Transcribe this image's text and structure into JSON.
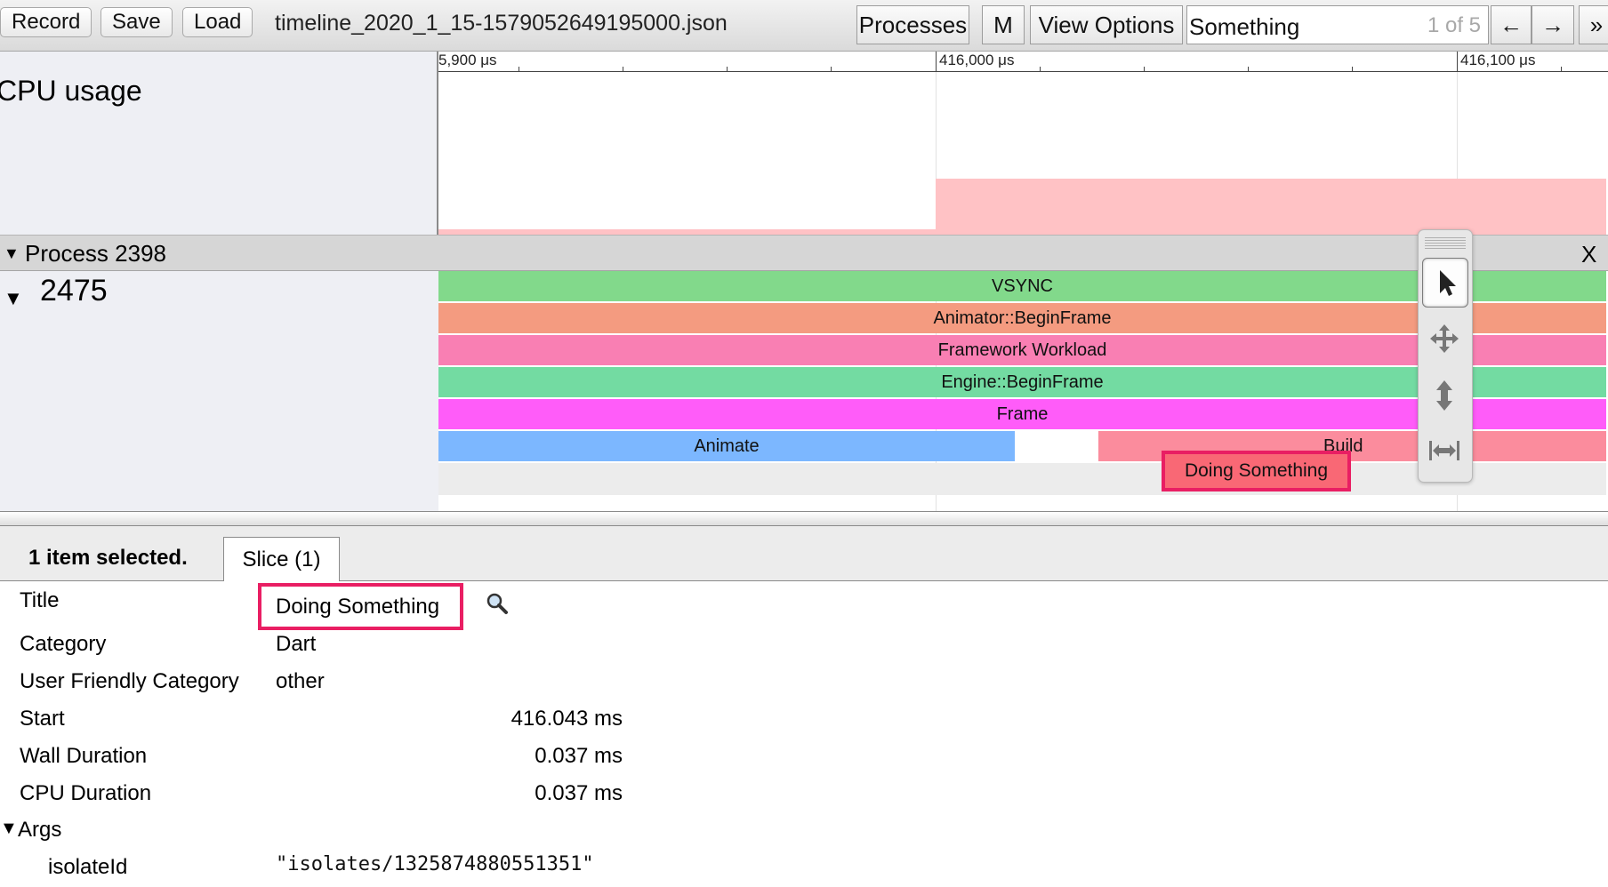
{
  "toolbar": {
    "record_label": "Record",
    "save_label": "Save",
    "load_label": "Load",
    "filename": "timeline_2020_1_15-1579052649195000.json",
    "processes_label": "Processes",
    "m_label": "M",
    "view_options_label": "View Options",
    "search_value": "Something",
    "search_count": "1 of 5",
    "prev_label": "←",
    "next_label": "→",
    "more_label": "»"
  },
  "ruler": {
    "labels": [
      "5,900 μs",
      "416,000 μs",
      "416,100 μs"
    ]
  },
  "tracks": {
    "cpu_label": "CPU usage",
    "process_title": "Process 2398",
    "process_close": "X",
    "thread_id": "2475"
  },
  "slices": {
    "vsync": "VSYNC",
    "animator_begin": "Animator::BeginFrame",
    "framework": "Framework Workload",
    "engine_begin": "Engine::BeginFrame",
    "frame": "Frame",
    "animate": "Animate",
    "build": "Build",
    "doing_something": "Doing Something"
  },
  "colors": {
    "vsync": "#82d98b",
    "animator_begin": "#f49b80",
    "framework": "#f97fb3",
    "engine_begin": "#73dba2",
    "frame": "#ff5cf9",
    "animate": "#7cb7ff",
    "build": "#fb8c9d",
    "doing_something": "#f96875",
    "selection": "#e91e63"
  },
  "panel": {
    "selected_text": "1 item selected.",
    "tab_label": "Slice (1)",
    "rows": {
      "title_label": "Title",
      "title_value": "Doing Something",
      "category_label": "Category",
      "category_value": "Dart",
      "ufc_label": "User Friendly Category",
      "ufc_value": "other",
      "start_label": "Start",
      "start_value": "416.043 ms",
      "wall_label": "Wall Duration",
      "wall_value": "0.037 ms",
      "cpu_label": "CPU Duration",
      "cpu_value": "0.037 ms",
      "args_label": "Args",
      "isolate_label": "isolateId",
      "isolate_value": "\"isolates/1325874880551351\""
    }
  }
}
